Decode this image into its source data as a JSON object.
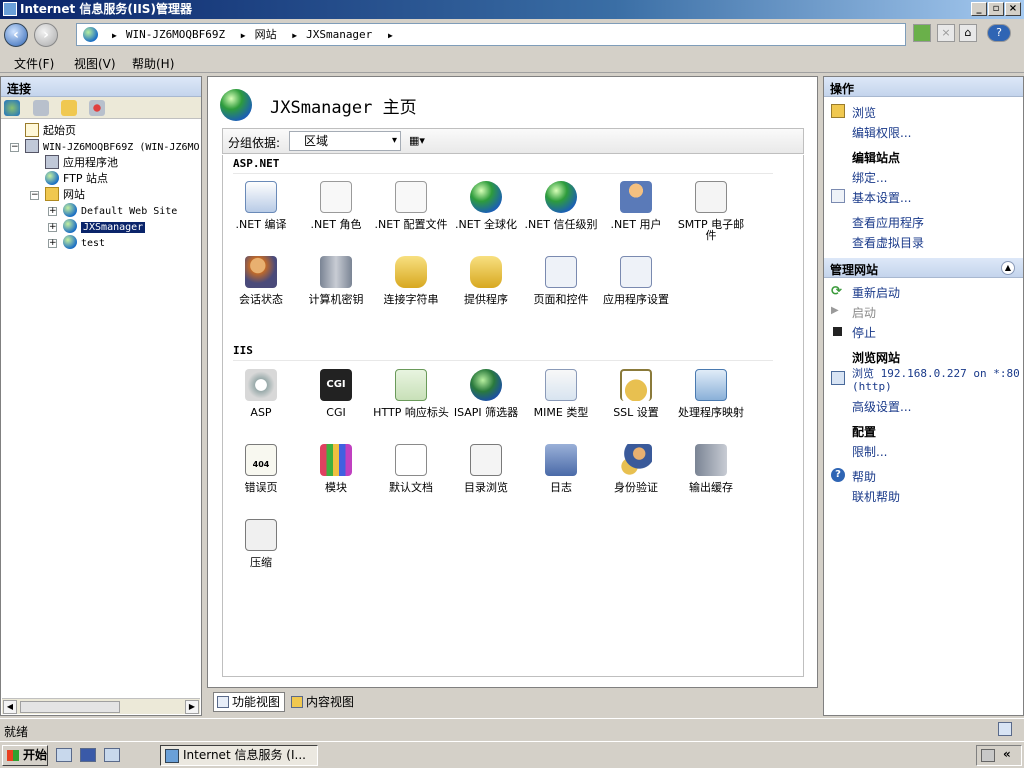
{
  "window": {
    "title": "Internet 信息服务(IIS)管理器"
  },
  "address": {
    "crumbs": [
      "WIN-JZ6MOQBF69Z",
      "网站",
      "JXSmanager"
    ]
  },
  "menu": {
    "file": "文件(F)",
    "view": "视图(V)",
    "help": "帮助(H)"
  },
  "connections": {
    "title": "连接",
    "tree": {
      "start_page": "起始页",
      "server": "WIN-JZ6MOQBF69Z (WIN-JZ6MO",
      "app_pools": "应用程序池",
      "ftp_sites": "FTP 站点",
      "sites": "网站",
      "default_site": "Default Web Site",
      "jxs": "JXSmanager",
      "test": "test"
    }
  },
  "center": {
    "title": "JXSmanager 主页",
    "group_by_label": "分组依据:",
    "group_by_value": "区域",
    "section_aspnet": "ASP.NET",
    "section_iis": "IIS",
    "aspnet_features": [
      ".NET 编译",
      ".NET 角色",
      ".NET 配置文件",
      ".NET 全球化",
      ".NET 信任级别",
      ".NET 用户",
      "SMTP 电子邮件",
      "会话状态",
      "计算机密钥",
      "连接字符串",
      "提供程序",
      "页面和控件",
      "应用程序设置"
    ],
    "iis_features": [
      "ASP",
      "CGI",
      "HTTP 响应标头",
      "ISAPI 筛选器",
      "MIME 类型",
      "SSL 设置",
      "处理程序映射",
      "错误页",
      "模块",
      "默认文档",
      "目录浏览",
      "日志",
      "身份验证",
      "输出缓存",
      "压缩"
    ],
    "tab_features": "功能视图",
    "tab_content": "内容视图"
  },
  "actions": {
    "title": "操作",
    "browse": "浏览",
    "edit_permissions": "编辑权限...",
    "edit_site": "编辑站点",
    "bindings": "绑定...",
    "basic_settings": "基本设置...",
    "view_apps": "查看应用程序",
    "view_vdirs": "查看虚拟目录",
    "manage_title": "管理网站",
    "restart": "重新启动",
    "start": "启动",
    "stop": "停止",
    "browse_site": "浏览网站",
    "browse_link": "浏览 192.168.0.227 on *:80",
    "browse_link2": "(http)",
    "advanced": "高级设置...",
    "configure": "配置",
    "limits": "限制...",
    "help": "帮助",
    "online_help": "联机帮助"
  },
  "status": {
    "text": "就绪"
  },
  "taskbar": {
    "start": "开始",
    "task": "Internet 信息服务 (I..."
  },
  "colors": {
    "selection": "#0a246a",
    "link": "#1a3a8a",
    "titlebar": "#0a246a"
  }
}
